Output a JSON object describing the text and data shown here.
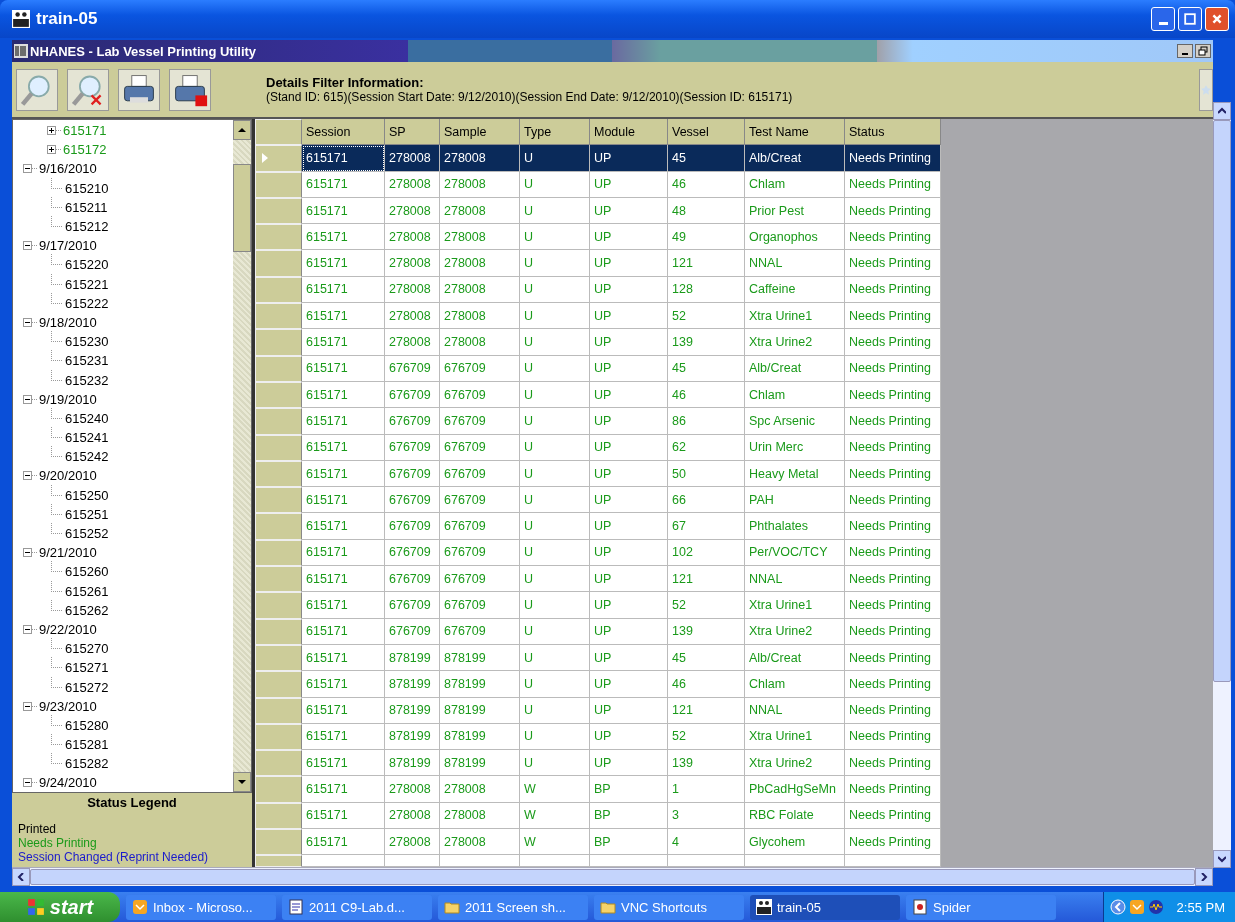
{
  "window": {
    "title": "train-05"
  },
  "app": {
    "title": "NHANES - Lab Vessel Printing Utility"
  },
  "filter": {
    "heading": "Details Filter Information:",
    "details": "(Stand ID: 615)(Session Start Date: 9/12/2010)(Session End Date: 9/12/2010)(Session ID: 615171)"
  },
  "tree": {
    "nodes": [
      {
        "label": "615171",
        "kind": "session",
        "expanded": false,
        "color": "#1a9a1a"
      },
      {
        "label": "615172",
        "kind": "session",
        "expanded": false,
        "color": "#1a9a1a"
      },
      {
        "label": "9/16/2010",
        "kind": "date",
        "expanded": true,
        "children": [
          {
            "label": "615210",
            "color": "#000000"
          },
          {
            "label": "615211",
            "color": "#000000"
          },
          {
            "label": "615212",
            "color": "#000000"
          }
        ]
      },
      {
        "label": "9/17/2010",
        "kind": "date",
        "expanded": true,
        "children": [
          {
            "label": "615220",
            "color": "#000000"
          },
          {
            "label": "615221",
            "color": "#000000"
          },
          {
            "label": "615222",
            "color": "#000000"
          }
        ]
      },
      {
        "label": "9/18/2010",
        "kind": "date",
        "expanded": true,
        "children": [
          {
            "label": "615230",
            "color": "#000000"
          },
          {
            "label": "615231",
            "color": "#000000"
          },
          {
            "label": "615232",
            "color": "#000000"
          }
        ]
      },
      {
        "label": "9/19/2010",
        "kind": "date",
        "expanded": true,
        "children": [
          {
            "label": "615240",
            "color": "#000000"
          },
          {
            "label": "615241",
            "color": "#000000"
          },
          {
            "label": "615242",
            "color": "#000000"
          }
        ]
      },
      {
        "label": "9/20/2010",
        "kind": "date",
        "expanded": true,
        "children": [
          {
            "label": "615250",
            "color": "#000000"
          },
          {
            "label": "615251",
            "color": "#000000"
          },
          {
            "label": "615252",
            "color": "#000000"
          }
        ]
      },
      {
        "label": "9/21/2010",
        "kind": "date",
        "expanded": true,
        "children": [
          {
            "label": "615260",
            "color": "#000000"
          },
          {
            "label": "615261",
            "color": "#000000"
          },
          {
            "label": "615262",
            "color": "#000000"
          }
        ]
      },
      {
        "label": "9/22/2010",
        "kind": "date",
        "expanded": true,
        "children": [
          {
            "label": "615270",
            "color": "#000000"
          },
          {
            "label": "615271",
            "color": "#000000"
          },
          {
            "label": "615272",
            "color": "#000000"
          }
        ]
      },
      {
        "label": "9/23/2010",
        "kind": "date",
        "expanded": true,
        "children": [
          {
            "label": "615280",
            "color": "#000000"
          },
          {
            "label": "615281",
            "color": "#000000"
          },
          {
            "label": "615282",
            "color": "#000000"
          }
        ]
      },
      {
        "label": "9/24/2010",
        "kind": "date",
        "expanded": true
      }
    ]
  },
  "legend": {
    "title": "Status Legend",
    "items": [
      {
        "label": "Printed",
        "color": "#000000"
      },
      {
        "label": "Needs Printing",
        "color": "#1a9a1a"
      },
      {
        "label": "Session Changed (Reprint Needed)",
        "color": "#1a1acc"
      }
    ]
  },
  "table": {
    "columns": [
      "Session",
      "SP",
      "Sample",
      "Type",
      "Module",
      "Vessel",
      "Test Name",
      "Status"
    ],
    "rows": [
      {
        "cells": [
          "615171",
          "278008",
          "278008",
          "U",
          "UP",
          "45",
          "Alb/Creat",
          "Needs Printing"
        ],
        "selected": true
      },
      {
        "cells": [
          "615171",
          "278008",
          "278008",
          "U",
          "UP",
          "46",
          "Chlam",
          "Needs Printing"
        ],
        "color": "#1a9a1a",
        "selected": false
      },
      {
        "cells": [
          "615171",
          "278008",
          "278008",
          "U",
          "UP",
          "48",
          "Prior Pest",
          "Needs Printing"
        ],
        "color": "#1a9a1a",
        "selected": false
      },
      {
        "cells": [
          "615171",
          "278008",
          "278008",
          "U",
          "UP",
          "49",
          "Organophos",
          "Needs Printing"
        ],
        "color": "#1a9a1a",
        "selected": false
      },
      {
        "cells": [
          "615171",
          "278008",
          "278008",
          "U",
          "UP",
          "121",
          "NNAL",
          "Needs Printing"
        ],
        "color": "#1a9a1a",
        "selected": false
      },
      {
        "cells": [
          "615171",
          "278008",
          "278008",
          "U",
          "UP",
          "128",
          "Caffeine",
          "Needs Printing"
        ],
        "color": "#1a9a1a",
        "selected": false
      },
      {
        "cells": [
          "615171",
          "278008",
          "278008",
          "U",
          "UP",
          "52",
          "Xtra Urine1",
          "Needs Printing"
        ],
        "color": "#1a9a1a",
        "selected": false
      },
      {
        "cells": [
          "615171",
          "278008",
          "278008",
          "U",
          "UP",
          "139",
          "Xtra Urine2",
          "Needs Printing"
        ],
        "color": "#1a9a1a",
        "selected": false
      },
      {
        "cells": [
          "615171",
          "676709",
          "676709",
          "U",
          "UP",
          "45",
          "Alb/Creat",
          "Needs Printing"
        ],
        "color": "#1a9a1a",
        "selected": false
      },
      {
        "cells": [
          "615171",
          "676709",
          "676709",
          "U",
          "UP",
          "46",
          "Chlam",
          "Needs Printing"
        ],
        "color": "#1a9a1a",
        "selected": false
      },
      {
        "cells": [
          "615171",
          "676709",
          "676709",
          "U",
          "UP",
          "86",
          "Spc Arsenic",
          "Needs Printing"
        ],
        "color": "#1a9a1a",
        "selected": false
      },
      {
        "cells": [
          "615171",
          "676709",
          "676709",
          "U",
          "UP",
          "62",
          "Urin Merc",
          "Needs Printing"
        ],
        "color": "#1a9a1a",
        "selected": false
      },
      {
        "cells": [
          "615171",
          "676709",
          "676709",
          "U",
          "UP",
          "50",
          "Heavy Metal",
          "Needs Printing"
        ],
        "color": "#1a9a1a",
        "selected": false
      },
      {
        "cells": [
          "615171",
          "676709",
          "676709",
          "U",
          "UP",
          "66",
          "PAH",
          "Needs Printing"
        ],
        "color": "#1a9a1a",
        "selected": false
      },
      {
        "cells": [
          "615171",
          "676709",
          "676709",
          "U",
          "UP",
          "67",
          "Phthalates",
          "Needs Printing"
        ],
        "color": "#1a9a1a",
        "selected": false
      },
      {
        "cells": [
          "615171",
          "676709",
          "676709",
          "U",
          "UP",
          "102",
          "Per/VOC/TCY",
          "Needs Printing"
        ],
        "color": "#1a9a1a",
        "selected": false
      },
      {
        "cells": [
          "615171",
          "676709",
          "676709",
          "U",
          "UP",
          "121",
          "NNAL",
          "Needs Printing"
        ],
        "color": "#1a9a1a",
        "selected": false
      },
      {
        "cells": [
          "615171",
          "676709",
          "676709",
          "U",
          "UP",
          "52",
          "Xtra Urine1",
          "Needs Printing"
        ],
        "color": "#1a9a1a",
        "selected": false
      },
      {
        "cells": [
          "615171",
          "676709",
          "676709",
          "U",
          "UP",
          "139",
          "Xtra Urine2",
          "Needs Printing"
        ],
        "color": "#1a9a1a",
        "selected": false
      },
      {
        "cells": [
          "615171",
          "878199",
          "878199",
          "U",
          "UP",
          "45",
          "Alb/Creat",
          "Needs Printing"
        ],
        "color": "#1a9a1a",
        "selected": false
      },
      {
        "cells": [
          "615171",
          "878199",
          "878199",
          "U",
          "UP",
          "46",
          "Chlam",
          "Needs Printing"
        ],
        "color": "#1a9a1a",
        "selected": false
      },
      {
        "cells": [
          "615171",
          "878199",
          "878199",
          "U",
          "UP",
          "121",
          "NNAL",
          "Needs Printing"
        ],
        "color": "#1a9a1a",
        "selected": false
      },
      {
        "cells": [
          "615171",
          "878199",
          "878199",
          "U",
          "UP",
          "52",
          "Xtra Urine1",
          "Needs Printing"
        ],
        "color": "#1a9a1a",
        "selected": false
      },
      {
        "cells": [
          "615171",
          "878199",
          "878199",
          "U",
          "UP",
          "139",
          "Xtra Urine2",
          "Needs Printing"
        ],
        "color": "#1a9a1a",
        "selected": false
      },
      {
        "cells": [
          "615171",
          "278008",
          "278008",
          "W",
          "BP",
          "1",
          "PbCadHgSeMn",
          "Needs Printing"
        ],
        "color": "#1a9a1a",
        "selected": false
      },
      {
        "cells": [
          "615171",
          "278008",
          "278008",
          "W",
          "BP",
          "3",
          "RBC Folate",
          "Needs Printing"
        ],
        "color": "#1a9a1a",
        "selected": false
      },
      {
        "cells": [
          "615171",
          "278008",
          "278008",
          "W",
          "BP",
          "4",
          "Glycohem",
          "Needs Printing"
        ],
        "color": "#1a9a1a",
        "selected": false
      }
    ]
  },
  "taskbar": {
    "start": "start",
    "items": [
      {
        "label": "Inbox - Microso...",
        "selected": false
      },
      {
        "label": "2011 C9-Lab.d...",
        "selected": false
      },
      {
        "label": "2011 Screen sh...",
        "selected": false
      },
      {
        "label": "VNC Shortcuts",
        "selected": false
      },
      {
        "label": "train-05",
        "selected": true
      },
      {
        "label": "Spider",
        "selected": false
      }
    ],
    "clock": "2:55 PM"
  }
}
